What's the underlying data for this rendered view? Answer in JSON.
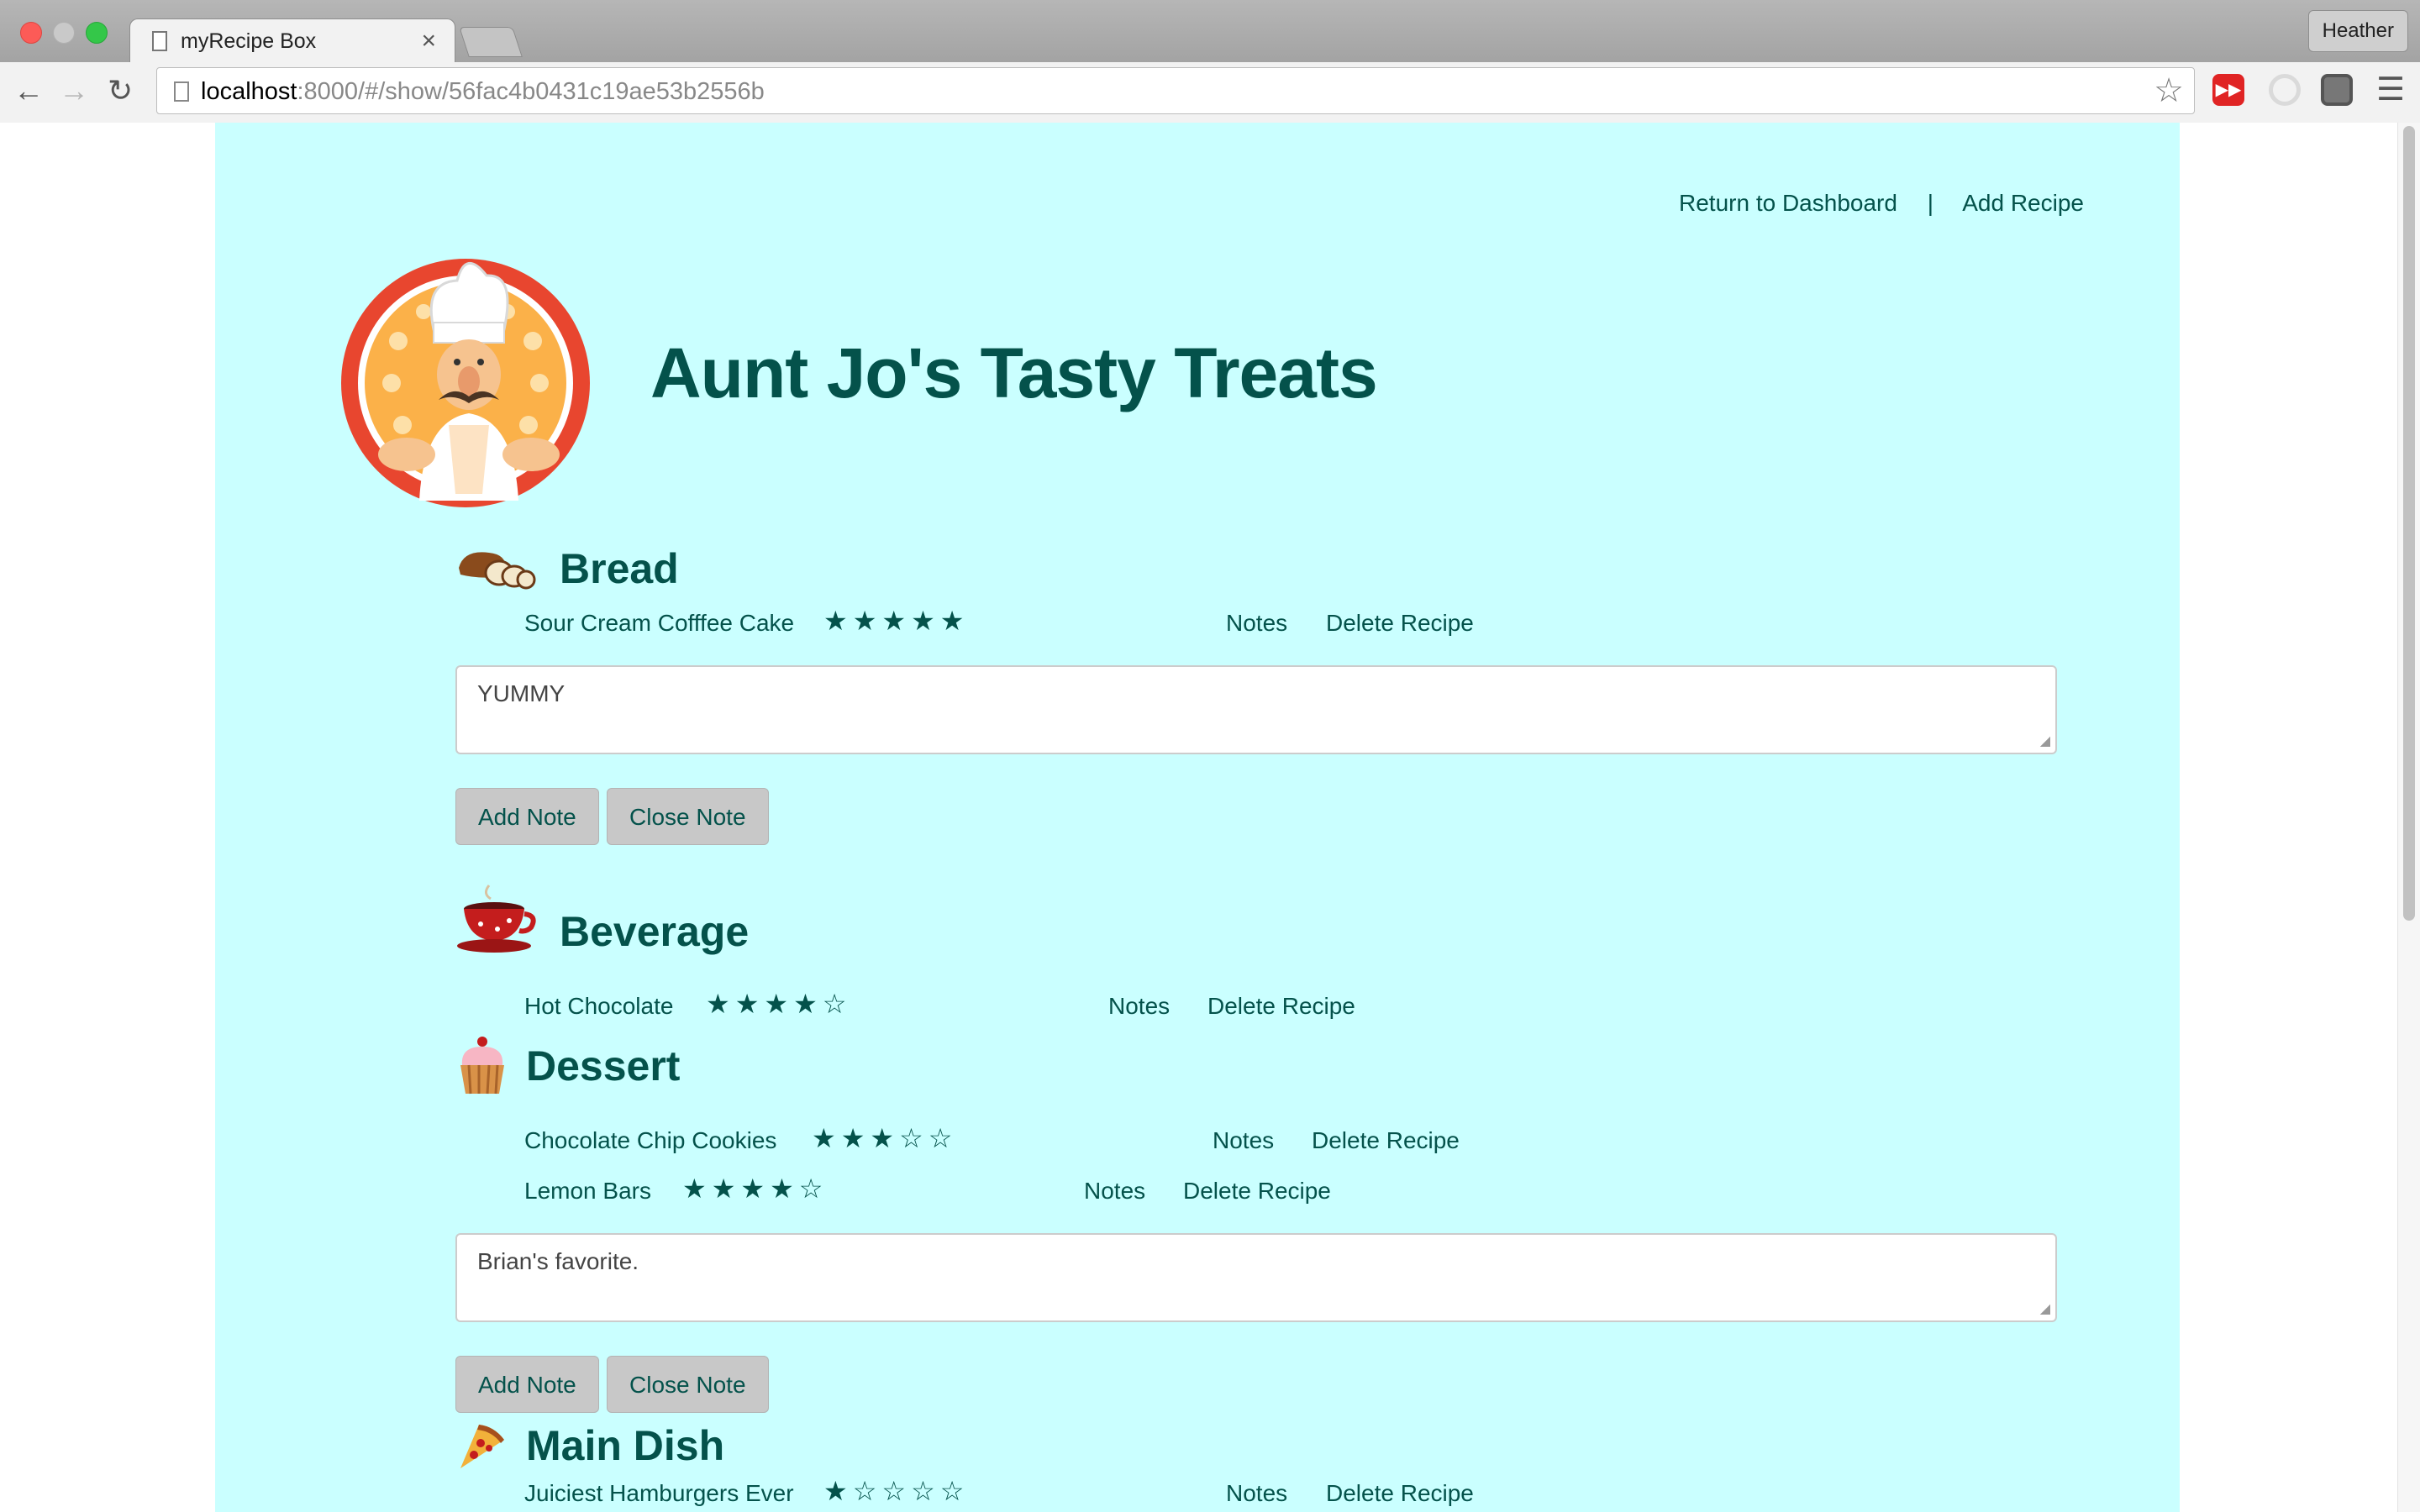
{
  "browser": {
    "tab_title": "myRecipe Box",
    "tab_close": "×",
    "profile_name": "Heather",
    "url_host": "localhost",
    "url_path": ":8000/#/show/56fac4b0431c19ae53b2556b",
    "icons": [
      "back-icon",
      "forward-icon",
      "reload-icon",
      "page-icon",
      "star-icon",
      "youtube-extension-icon",
      "sync-icon",
      "shield-extension-icon",
      "menu-icon"
    ]
  },
  "nav": {
    "dashboard_link": "Return to Dashboard",
    "separator": "|",
    "add_recipe_link": "Add Recipe"
  },
  "site": {
    "title": "Aunt Jo's Tasty Treats"
  },
  "categories": [
    {
      "name": "Bread",
      "icon": "bread-icon",
      "recipes": [
        {
          "name": "Sour Cream Cofffee Cake",
          "stars": "★★★★★",
          "rating": 5,
          "notes": "Notes",
          "delete": "Delete Recipe"
        }
      ],
      "note": {
        "value": "YUMMY",
        "add_label": "Add Note",
        "close_label": "Close Note"
      }
    },
    {
      "name": "Beverage",
      "icon": "teacup-icon",
      "recipes": [
        {
          "name": "Hot Chocolate",
          "stars": "★★★★☆",
          "rating": 4,
          "notes": "Notes",
          "delete": "Delete Recipe"
        }
      ]
    },
    {
      "name": "Dessert",
      "icon": "cupcake-icon",
      "recipes": [
        {
          "name": "Chocolate Chip Cookies",
          "stars": "★★★☆☆",
          "rating": 3,
          "notes": "Notes",
          "delete": "Delete Recipe"
        },
        {
          "name": "Lemon Bars",
          "stars": "★★★★☆",
          "rating": 4,
          "notes": "Notes",
          "delete": "Delete Recipe"
        }
      ],
      "note": {
        "value": "Brian's favorite.",
        "add_label": "Add Note",
        "close_label": "Close Note"
      }
    },
    {
      "name": "Main Dish",
      "icon": "pizza-icon",
      "recipes": [
        {
          "name": "Juiciest Hamburgers Ever",
          "stars": "★☆☆☆☆",
          "rating": 1,
          "notes": "Notes",
          "delete": "Delete Recipe"
        }
      ]
    }
  ],
  "colors": {
    "page_bg": "#caffff",
    "text": "#04524b",
    "button_bg": "#c8c8c8"
  }
}
